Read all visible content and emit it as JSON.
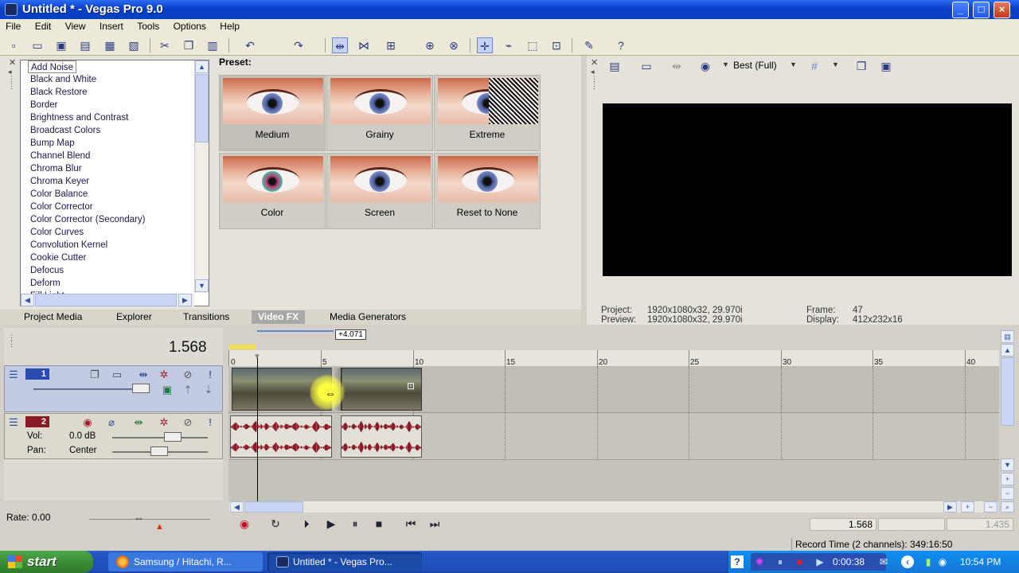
{
  "window": {
    "title": "Untitled * - Vegas Pro 9.0",
    "min": "_",
    "max": "□",
    "close": "×"
  },
  "menu": [
    "File",
    "Edit",
    "View",
    "Insert",
    "Tools",
    "Options",
    "Help"
  ],
  "fx_list": {
    "items": [
      "Add Noise",
      "Black and White",
      "Black Restore",
      "Border",
      "Brightness and Contrast",
      "Broadcast Colors",
      "Bump Map",
      "Channel Blend",
      "Chroma Blur",
      "Chroma Keyer",
      "Color Balance",
      "Color Corrector",
      "Color Corrector (Secondary)",
      "Color Curves",
      "Convolution Kernel",
      "Cookie Cutter",
      "Defocus",
      "Deform",
      "Fill Light"
    ],
    "selected": "Add Noise"
  },
  "presets": {
    "label": "Preset:",
    "items": [
      "Medium",
      "Grainy",
      "Extreme",
      "Color",
      "Screen",
      "Reset to None"
    ]
  },
  "tabs": [
    "Project Media",
    "Explorer",
    "Transitions",
    "Video FX",
    "Media Generators"
  ],
  "active_tab": "Video FX",
  "preview": {
    "quality": "Best (Full)",
    "project_label": "Project:",
    "project_value": "1920x1080x32, 29.970i",
    "preview_label": "Preview:",
    "preview_value": "1920x1080x32, 29.970i",
    "frame_label": "Frame:",
    "frame_value": "47",
    "display_label": "Display:",
    "display_value": "412x232x16"
  },
  "timeline": {
    "time": "1.568",
    "marker": "+4.071",
    "ruler": [
      "0",
      "5",
      "10",
      "15",
      "20",
      "25",
      "30",
      "35",
      "40"
    ],
    "track1_num": "1",
    "track2_num": "2",
    "vol_label": "Vol:",
    "vol_value": "0.0 dB",
    "pan_label": "Pan:",
    "pan_value": "Center",
    "rate": "Rate: 0.00"
  },
  "transport": {
    "cursor": "1.568",
    "end": "1.435"
  },
  "status": {
    "record_time": "Record Time (2 channels): 349:16:50"
  },
  "taskbar": {
    "start": "start",
    "tasks": [
      "Samsung / Hitachi, R...",
      "Untitled * - Vegas Pro..."
    ],
    "media_time": "0:00:38",
    "clock": "10:54 PM"
  }
}
